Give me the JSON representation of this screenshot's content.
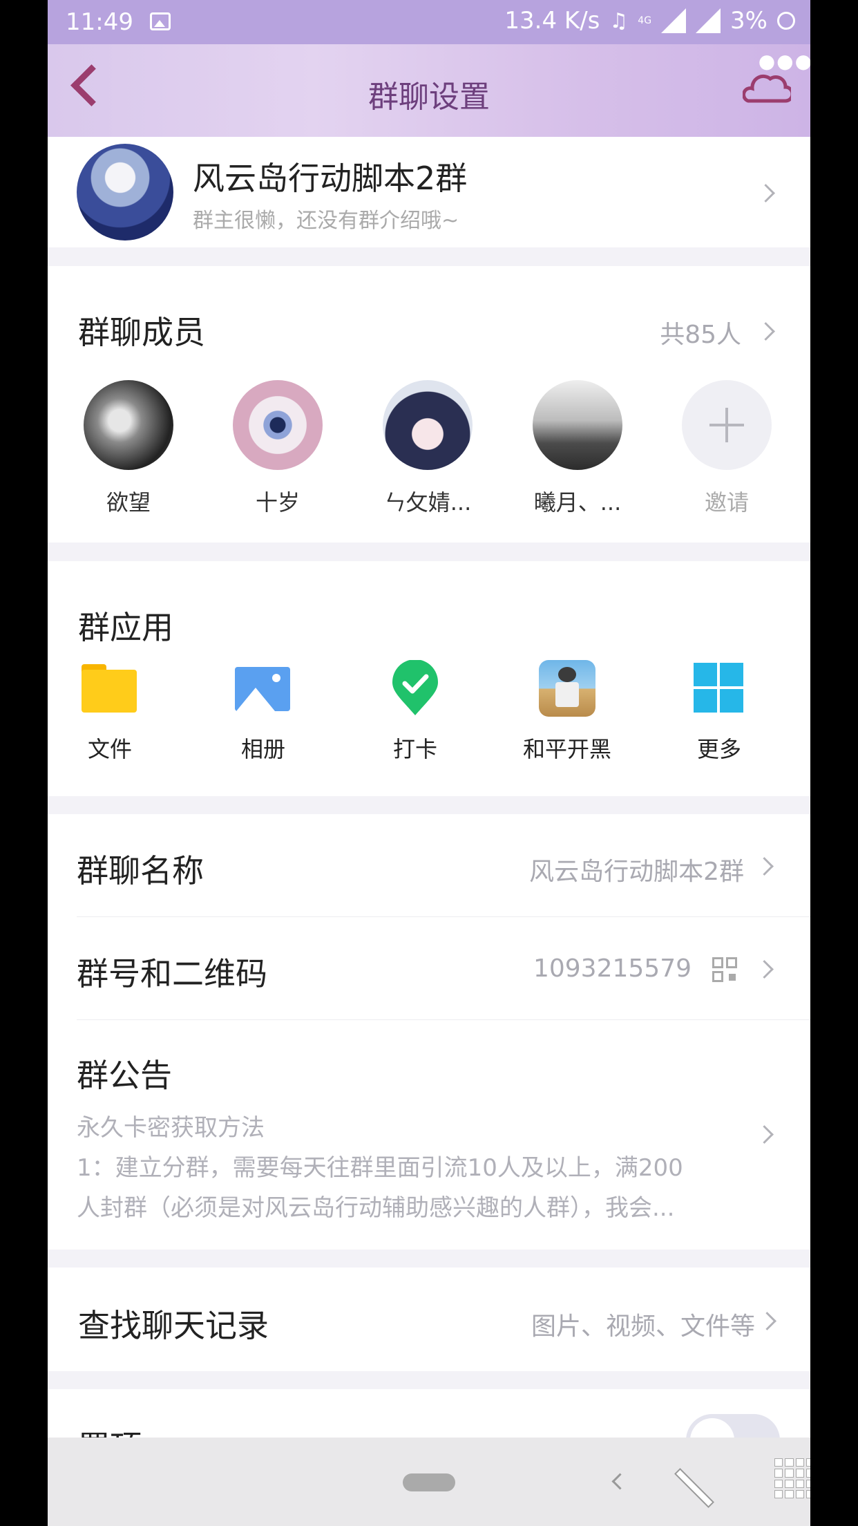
{
  "status_bar": {
    "time": "11:49",
    "speed": "13.4 K/s",
    "network": "4G",
    "battery": "3%"
  },
  "header": {
    "title": "群聊设置"
  },
  "group": {
    "name": "风云岛行动脚本2群",
    "intro": "群主很懒，还没有群介绍哦~"
  },
  "members": {
    "label": "群聊成员",
    "count": "共85人",
    "items": [
      {
        "name": "欲望"
      },
      {
        "name": "十岁"
      },
      {
        "name": "ㄣ攵婧..."
      },
      {
        "name": "曦月、..."
      }
    ],
    "invite_label": "邀请"
  },
  "apps": {
    "label": "群应用",
    "items": [
      {
        "name": "文件",
        "icon": "folder-icon"
      },
      {
        "name": "相册",
        "icon": "photo-album-icon"
      },
      {
        "name": "打卡",
        "icon": "check-in-icon"
      },
      {
        "name": "和平开黑",
        "icon": "game-icon"
      },
      {
        "name": "更多",
        "icon": "grid-more-icon"
      }
    ]
  },
  "settings": {
    "group_name_label": "群聊名称",
    "group_name_value": "风云岛行动脚本2群",
    "group_id_label": "群号和二维码",
    "group_id_value": "1093215579",
    "announcement_label": "群公告",
    "announcement_line1": "永久卡密获取方法",
    "announcement_line2": "1：建立分群，需要每天往群里面引流10人及以上，满200",
    "announcement_line3": "人封群（必须是对风云岛行动辅助感兴趣的人群），我会...",
    "search_label": "查找聊天记录",
    "search_value": "图片、视频、文件等",
    "pin_label": "置顶"
  },
  "colors": {
    "accent": "#9b3d6e",
    "status_bar": "#b7a3de",
    "secondary_text": "#a9a9b1"
  }
}
